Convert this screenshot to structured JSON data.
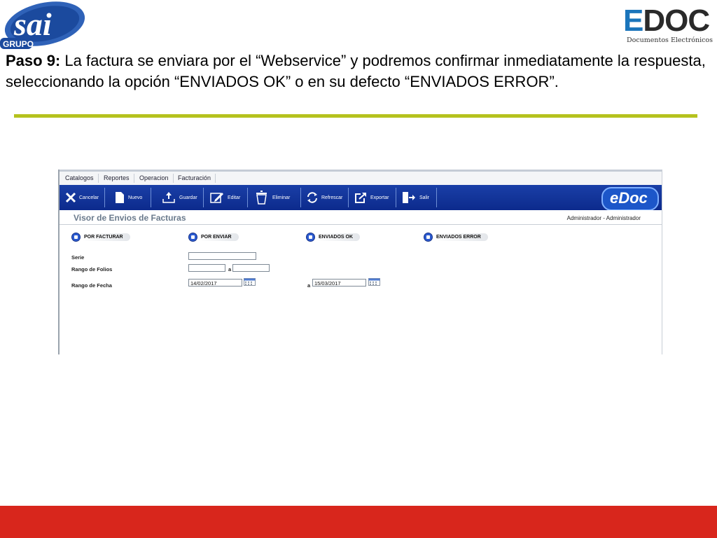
{
  "brand": {
    "left_logo_text": "sai",
    "left_logo_sub": "GRUPO",
    "right_logo_text": "EDOC",
    "right_logo_sub": "Documentos Electrónicos"
  },
  "intro": {
    "step_label": "Paso 9:",
    "text": " La factura se enviara por el “Webservice” y podremos confirmar inmediatamente la respuesta, seleccionando la opción “ENVIADOS OK” o en su defecto “ENVIADOS ERROR”."
  },
  "app": {
    "menu": [
      "Catalogos",
      "Reportes",
      "Operacion",
      "Facturación"
    ],
    "toolbar": {
      "cancel": "Cancelar",
      "new": "Nuevo",
      "save": "Guardar",
      "edit": "Editar",
      "delete": "Eliminar",
      "refresh": "Refrescar",
      "export": "Exportar",
      "exit": "Salir"
    },
    "app_logo": "eDoc",
    "window_title": "Visor de Envios de Facturas",
    "user": "Administrador - Administrador",
    "options": {
      "por_facturar": "POR FACTURAR",
      "por_enviar": "POR ENVIAR",
      "enviados_ok": "ENVIADOS OK",
      "enviados_error": "ENVIADOS ERROR"
    },
    "form": {
      "serie_label": "Serie",
      "serie_value": "",
      "folios_label": "Rango de Folios",
      "folio_from": "",
      "folio_sep": "a",
      "folio_to": "",
      "fecha_label": "Rango de Fecha",
      "fecha_from": "14/02/2017",
      "fecha_sep": "a",
      "fecha_to": "15/03/2017"
    }
  },
  "colors": {
    "accent_rule": "#b5c21e",
    "footer": "#d8261c",
    "toolbar": "#1a3fa7"
  }
}
